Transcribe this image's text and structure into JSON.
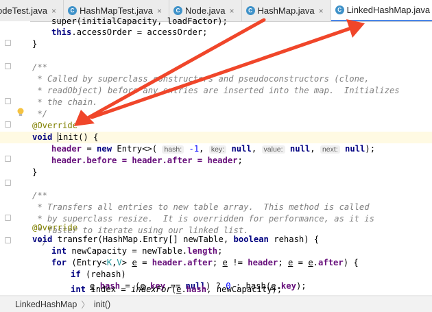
{
  "tabs": [
    {
      "label": "odeTest.java",
      "icon": "java-class-icon",
      "active": false
    },
    {
      "label": "HashMapTest.java",
      "icon": "java-class-icon",
      "active": false
    },
    {
      "label": "Node.java",
      "icon": "java-class-icon",
      "active": false
    },
    {
      "label": "HashMap.java",
      "icon": "java-class-icon",
      "active": false
    },
    {
      "label": "LinkedHashMap.java",
      "icon": "java-class-icon",
      "active": true
    }
  ],
  "tab_close_glyph": "×",
  "code": {
    "l0": "super(initialCapacity, loadFactor);",
    "l1_kw": "this",
    "l1_rest": ".accessOrder = accessOrder;",
    "l2": "}",
    "c1": "/**",
    "c2": " * Called by superclass constructors and pseudoconstructors (clone,",
    "c3": " * readObject) before any entries are inserted into the map.  Initializes",
    "c4": " * the chain.",
    "c5": " */",
    "override1": "@Override",
    "init_kw": "void",
    "init_name": "init",
    "init_rest": "() {",
    "h_header": "header",
    "h_eq": " = ",
    "h_new": "new",
    "h_entry": " Entry<>(",
    "hint_hash": "hash:",
    "h_val1": "-1",
    "hint_key": "key:",
    "null": "null",
    "hint_value": "value:",
    "hint_next": "next:",
    "h_end": ");",
    "b_line": ".before = ",
    "b_after": ".after = ",
    "semi": ";",
    "close": "}",
    "d1": "/**",
    "d2": " * Transfers all entries to new table array.  This method is called",
    "d3": " * by superclass resize.  It is overridden for performance, as it is",
    "d4": " * faster to iterate using our linked list.",
    "d5": " */",
    "override2": "@Override",
    "t_void": "void",
    "t_sig": " transfer(HashMap.Entry[] newTable, ",
    "t_boolean": "boolean",
    "t_end": " rehash) {",
    "n_int": "int",
    "n_mid": " newCapacity = newTable.",
    "n_length": "length",
    "for_kw": "for",
    "for_a": " (Entry<",
    "for_k": "K",
    "for_comma": ",",
    "for_v": "V",
    "for_b": "> ",
    "e": "e",
    "for_c": " = ",
    "after": "after",
    "for_d": "; ",
    "for_e": " != ",
    "for_f": "; ",
    "for_g": " = ",
    "for_h": ") {",
    "if_kw": "if",
    "if_rest": " (rehash)",
    "hash": "hash",
    "key": "key",
    "eh_a": ".",
    "eh_b": " = (",
    "eh_c": " == ",
    "eh_d": ") ? ",
    "zero": "0",
    "eh_e": " : hash(",
    "eh_f": ");",
    "idx_int": "int",
    "idx_a": " index = ",
    "indexFor": "indexFor",
    "idx_b": "(",
    "idx_c": ", newCapacity);"
  },
  "breadcrumb": {
    "class_name": "LinkedHashMap",
    "method": "init()",
    "separator": "〉"
  },
  "colors": {
    "arrow": "#f0462a",
    "keyword": "#000080",
    "comment": "#808080",
    "annotation": "#808000",
    "field": "#660e7a"
  }
}
